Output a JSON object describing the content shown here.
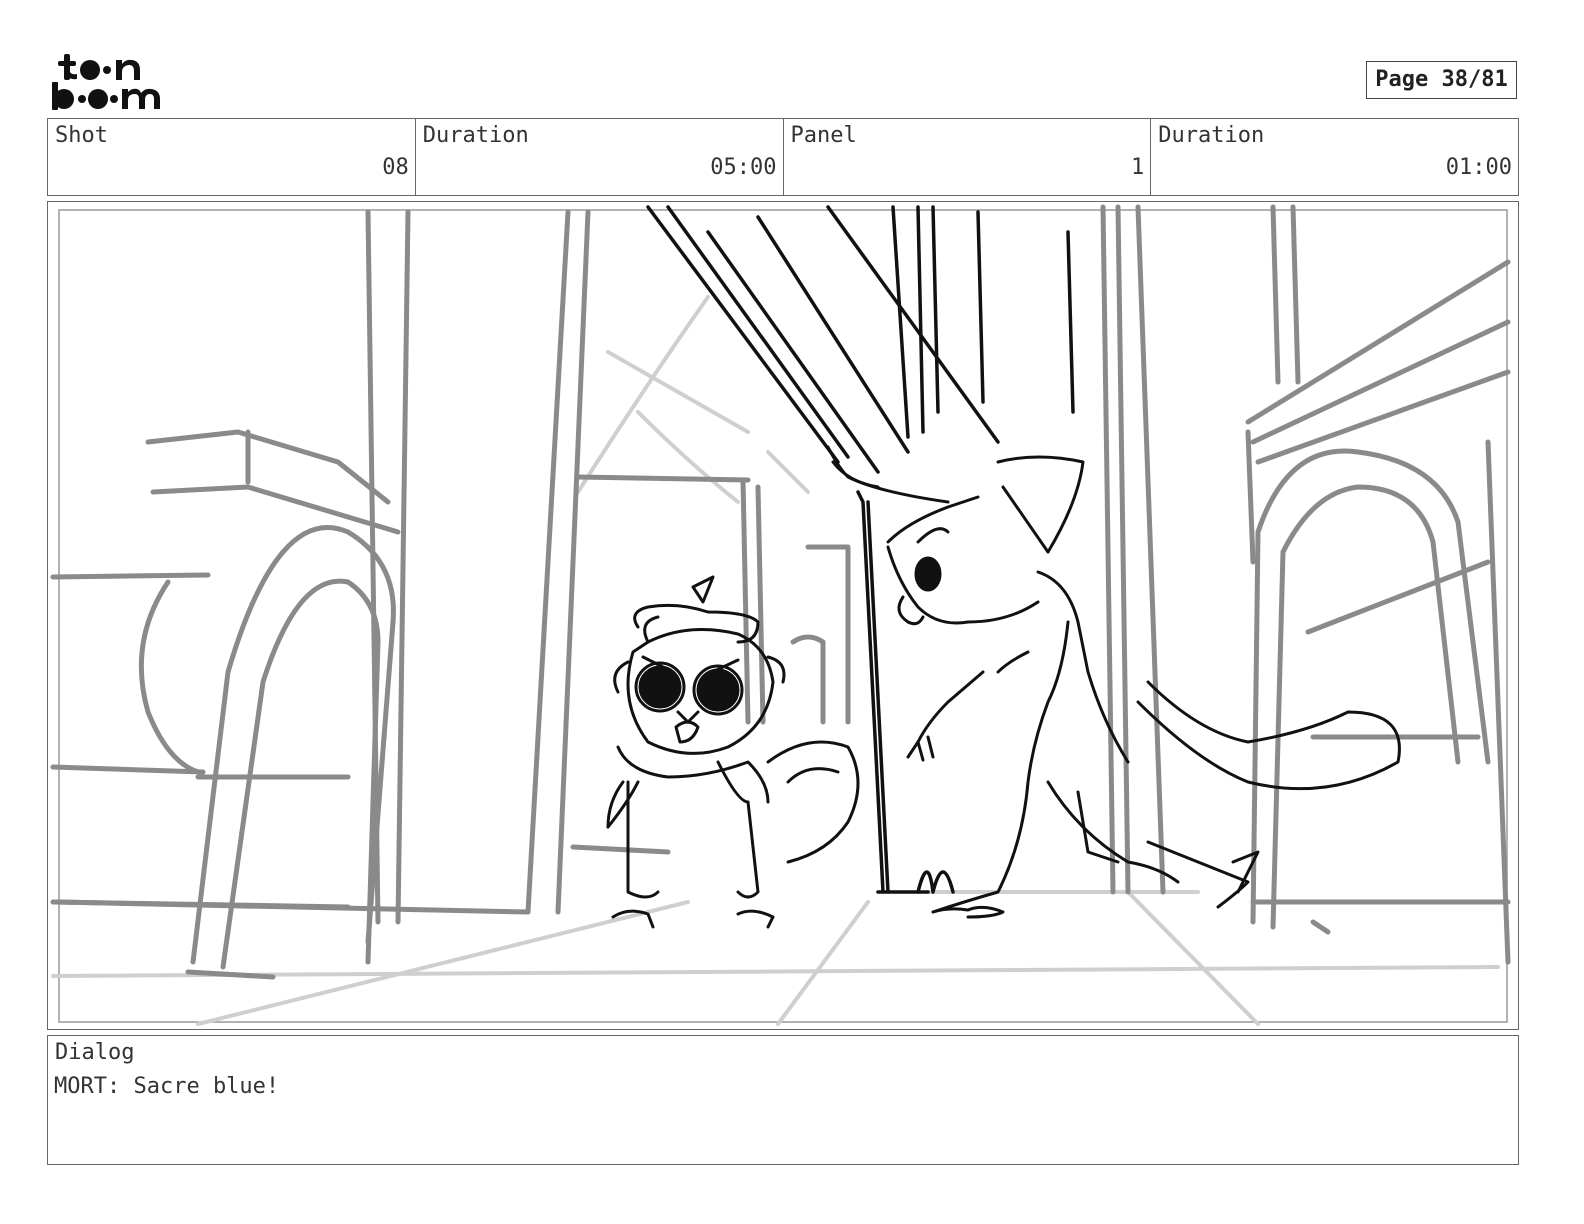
{
  "header": {
    "logo_text": "toon boom",
    "page_label": "Page 38/81"
  },
  "info": {
    "shot_label": "Shot",
    "shot_value": "08",
    "shot_duration_label": "Duration",
    "shot_duration_value": "05:00",
    "panel_label": "Panel",
    "panel_value": "1",
    "panel_duration_label": "Duration",
    "panel_duration_value": "01:00"
  },
  "dialog": {
    "label": "Dialog",
    "text": "MORT: Sacre blue!"
  }
}
